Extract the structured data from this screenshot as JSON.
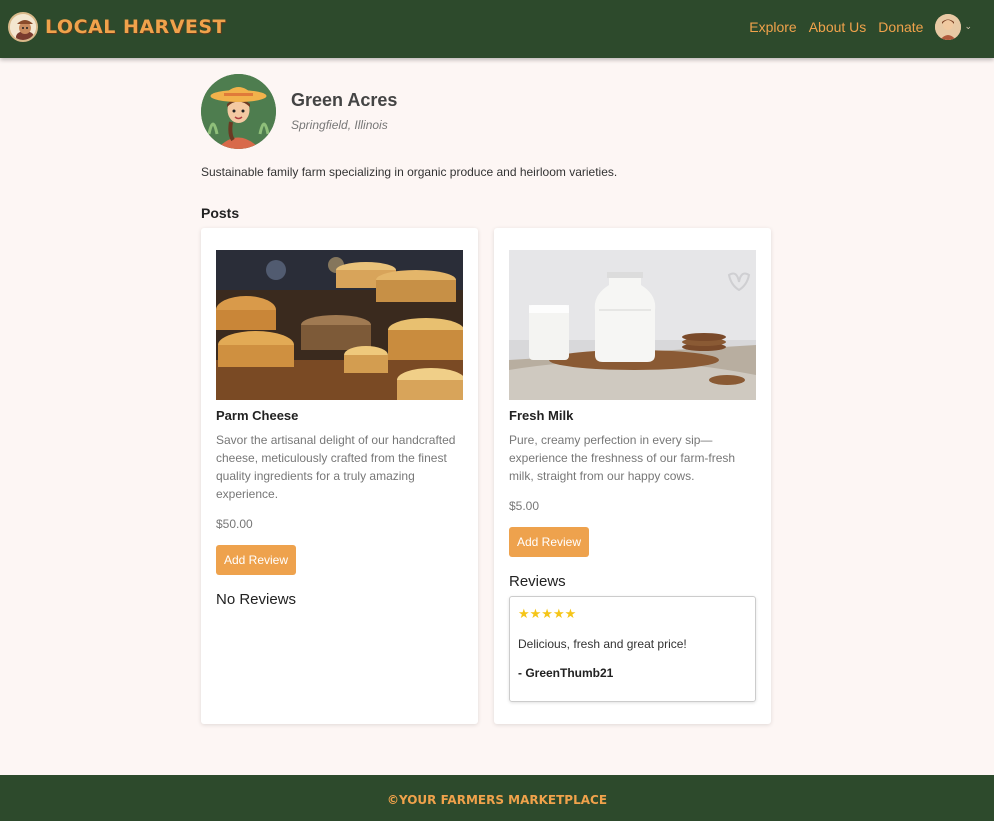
{
  "nav": {
    "brand": "LOCAL HARVEST",
    "links": [
      "Explore",
      "About Us",
      "Donate"
    ],
    "avatar_icon": "user-avatar-icon",
    "caret": "⌄"
  },
  "profile": {
    "name": "Green Acres",
    "location": "Springfield, Illinois",
    "bio": "Sustainable family farm specializing in organic produce and heirloom varieties."
  },
  "posts_heading": "Posts",
  "posts": [
    {
      "title": "Parm Cheese",
      "description": "Savor the artisanal delight of our handcrafted cheese, meticulously crafted from the finest quality ingredients for a truly amazing experience.",
      "price": "$50.00",
      "button": "Add Review",
      "reviews_heading": "No Reviews"
    },
    {
      "title": "Fresh Milk",
      "description": "Pure, creamy perfection in every sip—experience the freshness of our farm-fresh milk, straight from our happy cows.",
      "price": "$5.00",
      "button": "Add Review",
      "reviews_heading": "Reviews",
      "reviews": [
        {
          "stars": "★★★★★",
          "rating": 5,
          "text": "Delicious, fresh and great price!",
          "author": "- GreenThumb21"
        }
      ]
    }
  ],
  "footer": "©YOUR FARMERS MARKETPLACE",
  "colors": {
    "nav_bg": "#2d4a2c",
    "accent": "#f0a24b",
    "button": "#eea24d",
    "page_bg": "#fdf6f4",
    "star": "#f5c518"
  }
}
